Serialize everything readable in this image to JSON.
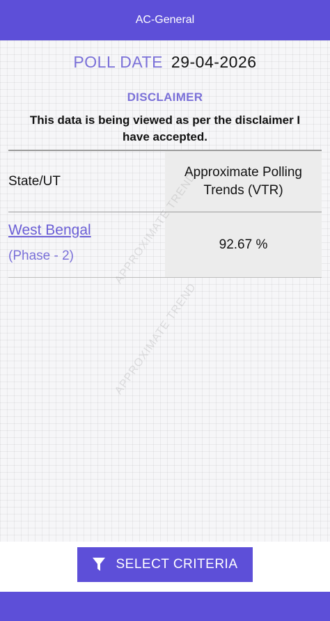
{
  "header": {
    "title": "AC-General"
  },
  "poll": {
    "label": "POLL DATE",
    "date": "29-04-2026"
  },
  "disclaimer": {
    "title": "DISCLAIMER",
    "text": "This data is being viewed as per the disclaimer I have accepted."
  },
  "table": {
    "headers": {
      "state": "State/UT",
      "vtr": "Approximate Polling Trends (VTR)"
    },
    "rows": [
      {
        "state": "West Bengal",
        "phase": "(Phase - 2)",
        "value": "92.67 %"
      }
    ]
  },
  "watermark": "APPROXIMATE TREND",
  "footer": {
    "button_label": "SELECT CRITERIA",
    "button_icon": "filter-icon"
  },
  "colors": {
    "primary": "#5d4fd8",
    "accent_text": "#7a70d8",
    "cell_bg": "#ececec"
  }
}
